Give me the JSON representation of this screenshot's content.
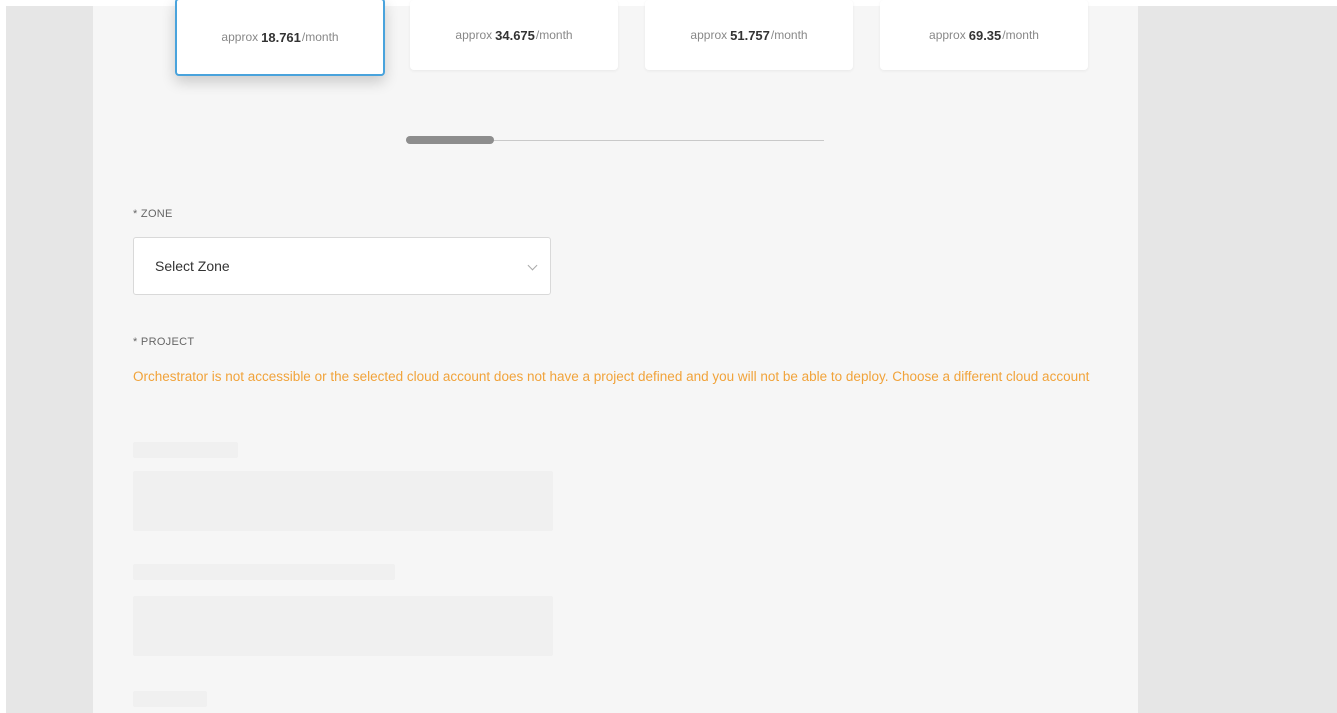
{
  "plans": [
    {
      "prefix": "approx",
      "price": "18.761",
      "suffix": "/month",
      "selected": true
    },
    {
      "prefix": "approx",
      "price": "34.675",
      "suffix": "/month",
      "selected": false
    },
    {
      "prefix": "approx",
      "price": "51.757",
      "suffix": "/month",
      "selected": false
    },
    {
      "prefix": "approx",
      "price": "69.35",
      "suffix": "/month",
      "selected": false
    }
  ],
  "zone": {
    "label": "* ZONE",
    "value": "Select Zone",
    "icon": "chevron-down-icon"
  },
  "project": {
    "label": "* PROJECT",
    "warning": "Orchestrator is not accessible or the selected cloud account does not have a project defined and you will not be able to deploy. Choose a different cloud account"
  },
  "colors": {
    "accent": "#49a3dc",
    "warning": "#f1a33a",
    "panel": "#f6f6f6",
    "background": "#e6e6e6"
  }
}
